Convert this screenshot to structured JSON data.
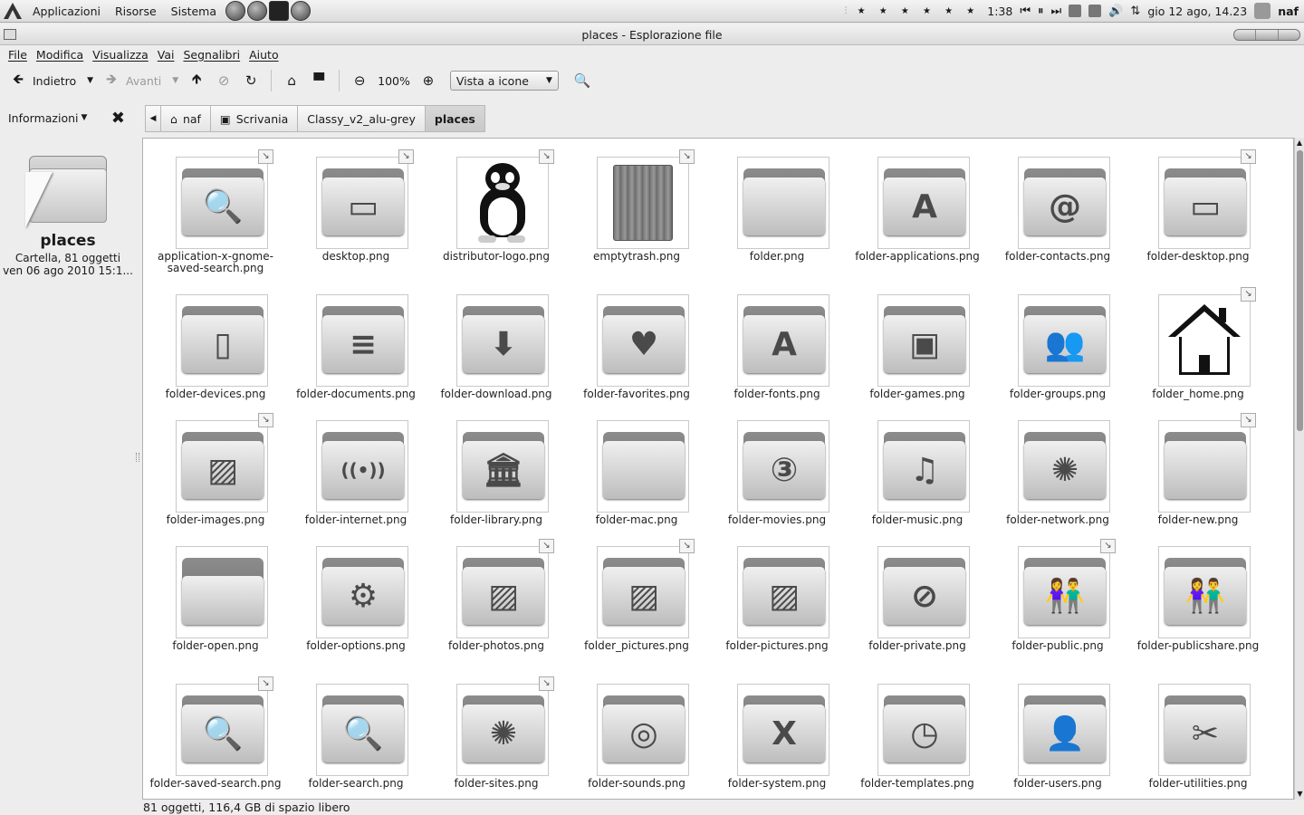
{
  "panel": {
    "menus": [
      "Applicazioni",
      "Risorse",
      "Sistema"
    ],
    "music_time": "1:38",
    "stars": "★ ★ ★ ★ ★ ★",
    "clock": "gio 12 ago, 14.23",
    "user": "naf"
  },
  "window": {
    "title": "places - Esplorazione file"
  },
  "menubar": [
    "File",
    "Modifica",
    "Visualizza",
    "Vai",
    "Segnalibri",
    "Aiuto"
  ],
  "toolbar": {
    "back_label": "Indietro",
    "forward_label": "Avanti",
    "zoom_level": "100%",
    "view_mode": "Vista a icone"
  },
  "sidebar": {
    "title": "Informazioni",
    "place_name": "places",
    "info_line1": "Cartella, 81 oggetti",
    "info_line2": "ven 06 ago 2010 15:1..."
  },
  "pathbar": [
    "naf",
    "Scrivania",
    "Classy_v2_alu-grey",
    "places"
  ],
  "files": [
    {
      "name": "application-x-gnome-saved-search.png",
      "glyph": "🔍",
      "link": true,
      "kind": "folder"
    },
    {
      "name": "desktop.png",
      "glyph": "▭",
      "link": true,
      "kind": "folder"
    },
    {
      "name": "distributor-logo.png",
      "glyph": "",
      "link": true,
      "kind": "penguin"
    },
    {
      "name": "emptytrash.png",
      "glyph": "",
      "link": true,
      "kind": "trash"
    },
    {
      "name": "folder.png",
      "glyph": "",
      "link": false,
      "kind": "folder"
    },
    {
      "name": "folder-applications.png",
      "glyph": "A",
      "link": false,
      "kind": "folder"
    },
    {
      "name": "folder-contacts.png",
      "glyph": "@",
      "link": false,
      "kind": "folder"
    },
    {
      "name": "folder-desktop.png",
      "glyph": "▭",
      "link": true,
      "kind": "folder"
    },
    {
      "name": "folder-devices.png",
      "glyph": "▯",
      "link": false,
      "kind": "folder"
    },
    {
      "name": "folder-documents.png",
      "glyph": "≡",
      "link": false,
      "kind": "folder"
    },
    {
      "name": "folder-download.png",
      "glyph": "⬇",
      "link": false,
      "kind": "folder"
    },
    {
      "name": "folder-favorites.png",
      "glyph": "♥",
      "link": false,
      "kind": "folder"
    },
    {
      "name": "folder-fonts.png",
      "glyph": "A",
      "link": false,
      "kind": "folder"
    },
    {
      "name": "folder-games.png",
      "glyph": "▣",
      "link": false,
      "kind": "folder"
    },
    {
      "name": "folder-groups.png",
      "glyph": "👥",
      "link": false,
      "kind": "folder"
    },
    {
      "name": "folder_home.png",
      "glyph": "",
      "link": true,
      "kind": "house"
    },
    {
      "name": "folder-images.png",
      "glyph": "▨",
      "link": true,
      "kind": "folder"
    },
    {
      "name": "folder-internet.png",
      "glyph": "((•))",
      "link": false,
      "kind": "folder"
    },
    {
      "name": "folder-library.png",
      "glyph": "🏛",
      "link": false,
      "kind": "folder"
    },
    {
      "name": "folder-mac.png",
      "glyph": "",
      "link": false,
      "kind": "folder"
    },
    {
      "name": "folder-movies.png",
      "glyph": "③",
      "link": false,
      "kind": "folder"
    },
    {
      "name": "folder-music.png",
      "glyph": "♫",
      "link": false,
      "kind": "folder"
    },
    {
      "name": "folder-network.png",
      "glyph": "✺",
      "link": false,
      "kind": "folder"
    },
    {
      "name": "folder-new.png",
      "glyph": "",
      "link": true,
      "kind": "folder"
    },
    {
      "name": "folder-open.png",
      "glyph": "",
      "link": false,
      "kind": "folder-open"
    },
    {
      "name": "folder-options.png",
      "glyph": "⚙",
      "link": false,
      "kind": "folder"
    },
    {
      "name": "folder-photos.png",
      "glyph": "▨",
      "link": true,
      "kind": "folder"
    },
    {
      "name": "folder_pictures.png",
      "glyph": "▨",
      "link": true,
      "kind": "folder"
    },
    {
      "name": "folder-pictures.png",
      "glyph": "▨",
      "link": false,
      "kind": "folder"
    },
    {
      "name": "folder-private.png",
      "glyph": "⊘",
      "link": false,
      "kind": "folder"
    },
    {
      "name": "folder-public.png",
      "glyph": "👫",
      "link": true,
      "kind": "folder"
    },
    {
      "name": "folder-publicshare.png",
      "glyph": "👫",
      "link": false,
      "kind": "folder"
    },
    {
      "name": "folder-saved-search.png",
      "glyph": "🔍",
      "link": true,
      "kind": "folder"
    },
    {
      "name": "folder-search.png",
      "glyph": "🔍",
      "link": false,
      "kind": "folder"
    },
    {
      "name": "folder-sites.png",
      "glyph": "✺",
      "link": true,
      "kind": "folder"
    },
    {
      "name": "folder-sounds.png",
      "glyph": "◎",
      "link": false,
      "kind": "folder"
    },
    {
      "name": "folder-system.png",
      "glyph": "X",
      "link": false,
      "kind": "folder"
    },
    {
      "name": "folder-templates.png",
      "glyph": "◷",
      "link": false,
      "kind": "folder"
    },
    {
      "name": "folder-users.png",
      "glyph": "👤",
      "link": false,
      "kind": "folder"
    },
    {
      "name": "folder-utilities.png",
      "glyph": "✂",
      "link": false,
      "kind": "folder"
    }
  ],
  "status": "81 oggetti, 116,4 GB di spazio libero"
}
